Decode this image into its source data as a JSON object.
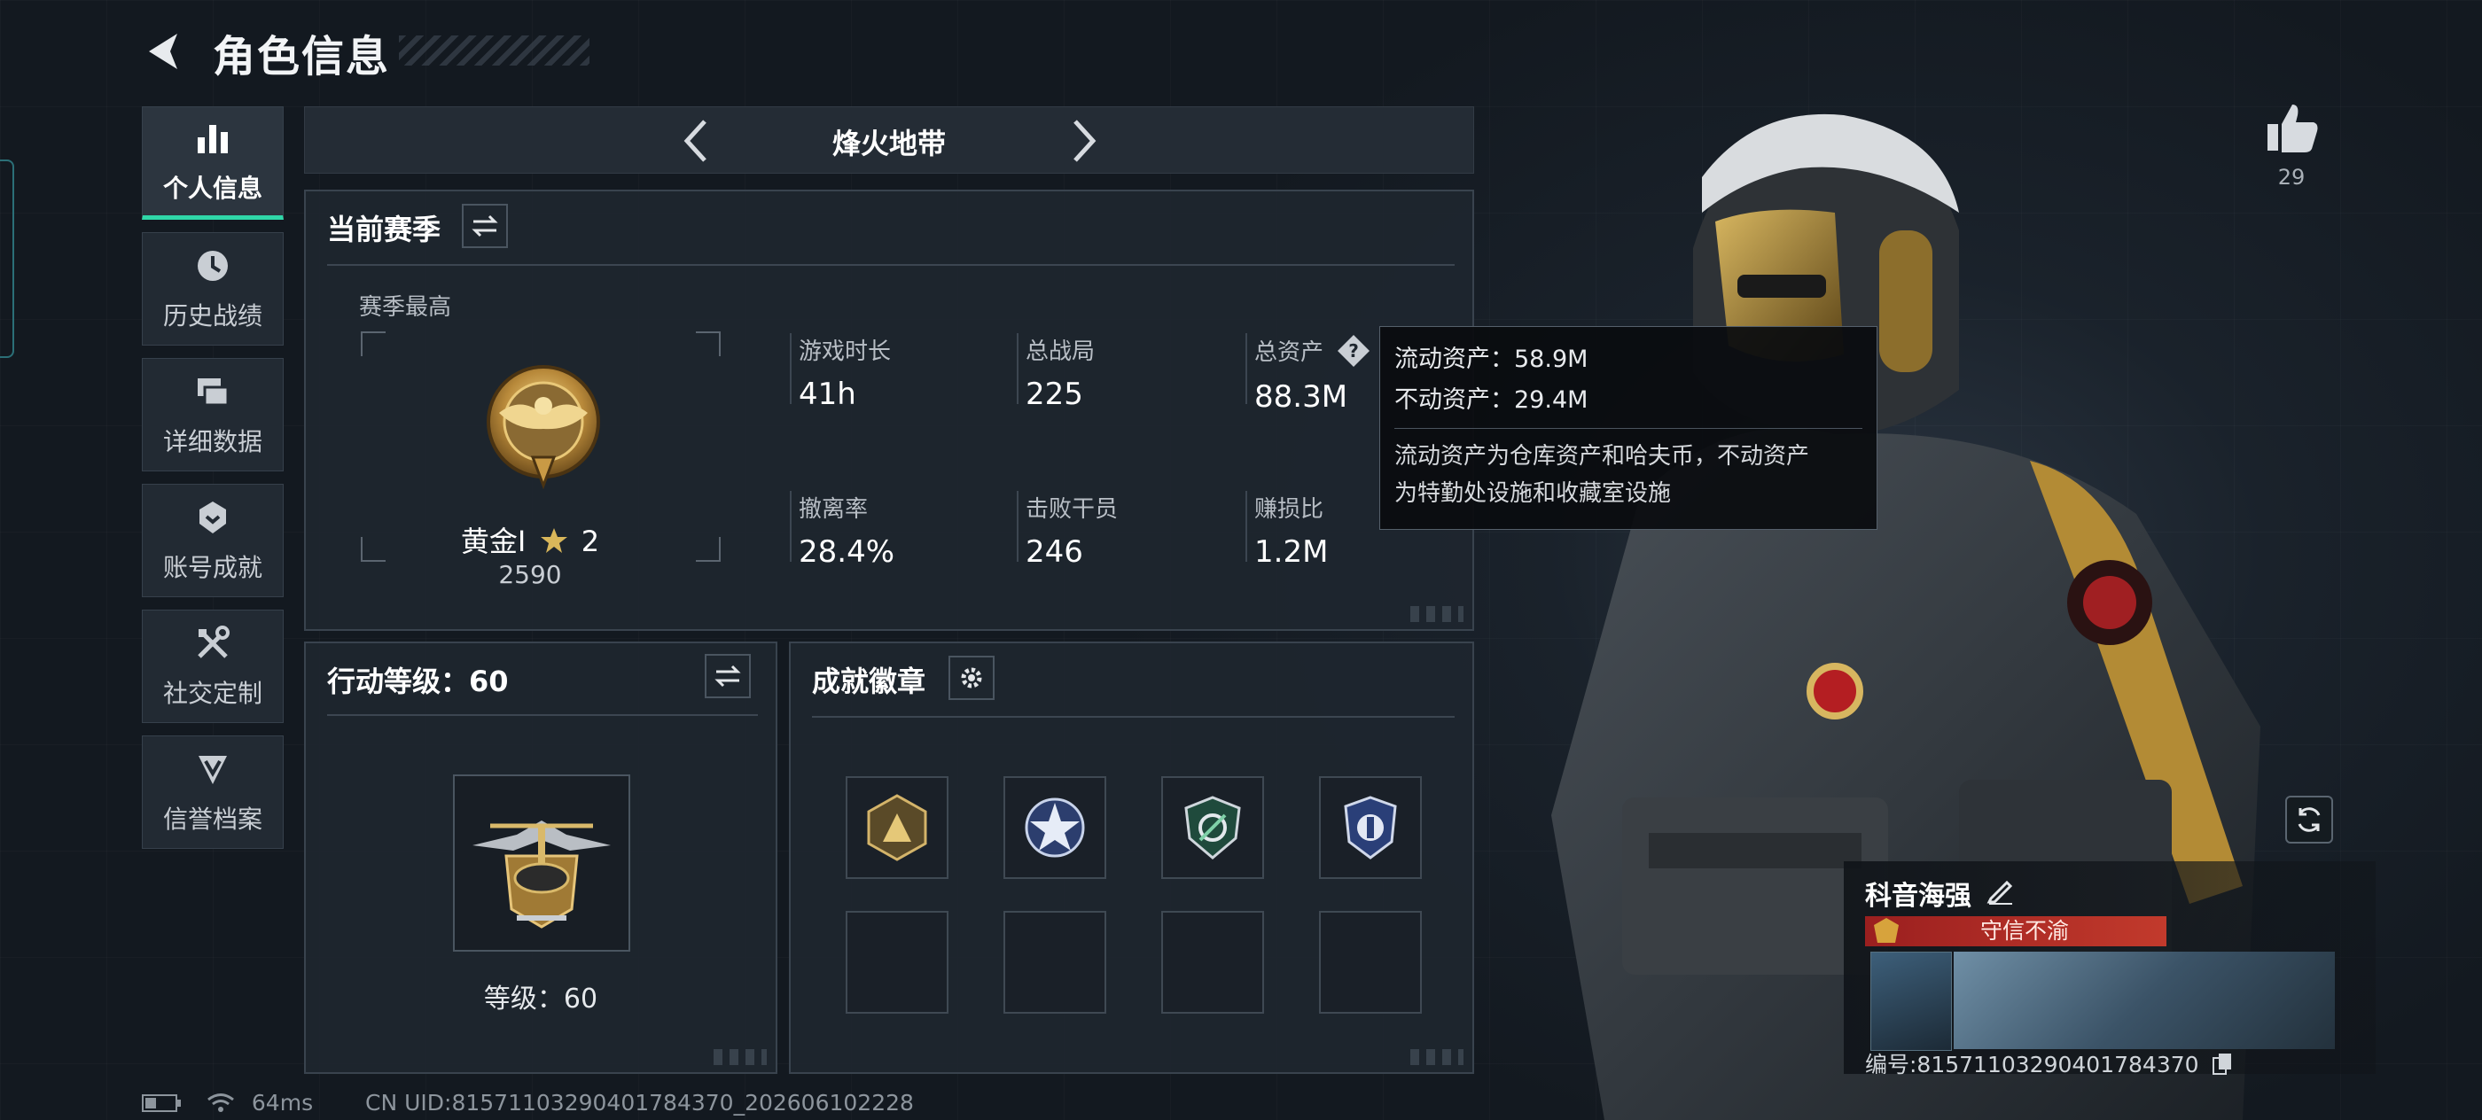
{
  "header": {
    "title": "角色信息"
  },
  "nav": {
    "items": [
      {
        "label": "个人信息",
        "icon": "bar-chart-icon",
        "active": true
      },
      {
        "label": "历史战绩",
        "icon": "clock-icon",
        "active": false
      },
      {
        "label": "详细数据",
        "icon": "stacked-cards-icon",
        "active": false
      },
      {
        "label": "账号成就",
        "icon": "achievement-icon",
        "active": false
      },
      {
        "label": "社交定制",
        "icon": "tools-icon",
        "active": false
      },
      {
        "label": "信誉档案",
        "icon": "credit-shield-icon",
        "active": false
      }
    ]
  },
  "mode": {
    "title": "烽火地带"
  },
  "season": {
    "title": "当前赛季",
    "best_label": "赛季最高",
    "rank_name": "黄金I",
    "rank_stars": "2",
    "rank_score": "2590",
    "stats": [
      {
        "label": "游戏时长",
        "value": "41h"
      },
      {
        "label": "总战局",
        "value": "225"
      },
      {
        "label": "总资产",
        "value": "88.3M"
      },
      {
        "label": "撤离率",
        "value": "28.4%"
      },
      {
        "label": "击败干员",
        "value": "246"
      },
      {
        "label": "赚损比",
        "value": "1.2M"
      }
    ]
  },
  "tooltip": {
    "liquid": "流动资产：58.9M",
    "fixed": "不动资产：29.4M",
    "desc_line1": "流动资产为仓库资产和哈夫币，不动资产",
    "desc_line2": "为特勤处设施和收藏室设施"
  },
  "level_panel": {
    "title": "行动等级：60",
    "level_text": "等级：60"
  },
  "badges_panel": {
    "title": "成就徽章",
    "filled_slots": 4,
    "total_slots": 8
  },
  "profile": {
    "likes": "29",
    "name": "科音海强",
    "honor": "守信不渝",
    "id_text": "编号:815711032904017843​70"
  },
  "status": {
    "ping": "64ms",
    "uid": "CN UID:815711032904017843​70_202606102228"
  },
  "colors": {
    "accent": "#2fd7a8",
    "honor_red": "#b0282a",
    "gold": "#c9a24a"
  }
}
